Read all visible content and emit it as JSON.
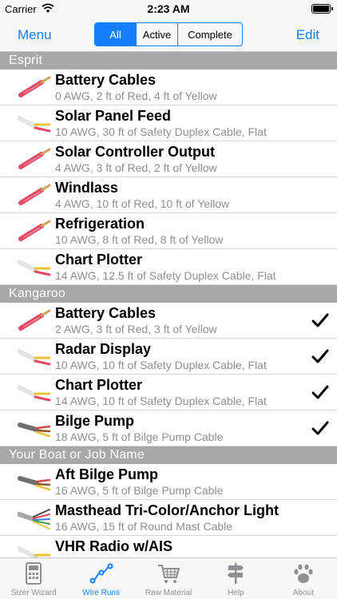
{
  "status_bar": {
    "carrier": "Carrier",
    "time": "2:23 AM"
  },
  "nav": {
    "left_button": "Menu",
    "right_button": "Edit",
    "segments": [
      "All",
      "Active",
      "Complete"
    ],
    "selected_segment": "All"
  },
  "sections": [
    {
      "title": "Esprit",
      "rows": [
        {
          "title": "Battery Cables",
          "subtitle": "0 AWG, 2 ft of Red, 4 ft of Yellow",
          "icon": "red-wire-icon",
          "checked": false
        },
        {
          "title": "Solar Panel Feed",
          "subtitle": "10 AWG, 30 ft of Safety Duplex Cable, Flat",
          "icon": "duplex-cable-icon",
          "checked": false
        },
        {
          "title": "Solar Controller Output",
          "subtitle": "4 AWG, 3 ft of Red, 2 ft of Yellow",
          "icon": "red-wire-icon",
          "checked": false
        },
        {
          "title": "Windlass",
          "subtitle": "4 AWG, 10 ft of Red, 10 ft of Yellow",
          "icon": "red-wire-icon",
          "checked": false
        },
        {
          "title": "Refrigeration",
          "subtitle": "10 AWG, 8 ft of Red, 8 ft of Yellow",
          "icon": "red-wire-icon",
          "checked": false
        },
        {
          "title": "Chart Plotter",
          "subtitle": "14 AWG, 12.5 ft of Safety Duplex Cable, Flat",
          "icon": "duplex-cable-icon",
          "checked": false
        }
      ]
    },
    {
      "title": "Kangaroo",
      "rows": [
        {
          "title": "Battery Cables",
          "subtitle": "2 AWG, 3 ft of Red, 3 ft of Yellow",
          "icon": "red-wire-icon",
          "checked": true
        },
        {
          "title": "Radar Display",
          "subtitle": "10 AWG, 10 ft of Safety Duplex Cable, Flat",
          "icon": "duplex-cable-icon",
          "checked": true
        },
        {
          "title": "Chart Plotter",
          "subtitle": "14 AWG, 10 ft of Safety Duplex Cable, Flat",
          "icon": "duplex-cable-icon",
          "checked": true
        },
        {
          "title": "Bilge Pump",
          "subtitle": "18 AWG, 5 ft of Bilge Pump Cable",
          "icon": "bilge-pump-cable-icon",
          "checked": true
        }
      ]
    },
    {
      "title": "Your Boat or Job Name",
      "rows": [
        {
          "title": "Aft Bilge Pump",
          "subtitle": "16 AWG, 5 ft of Bilge Pump Cable",
          "icon": "bilge-pump-cable-icon",
          "checked": false
        },
        {
          "title": "Masthead Tri-Color/Anchor Light",
          "subtitle": "16 AWG, 15 ft of Round Mast Cable",
          "icon": "mast-cable-icon",
          "checked": false
        },
        {
          "title": "VHR Radio w/AIS",
          "subtitle": "",
          "icon": "duplex-cable-icon",
          "checked": false
        }
      ]
    }
  ],
  "tab_bar": [
    {
      "label": "Sizer Wizard",
      "icon": "calculator-icon",
      "active": false
    },
    {
      "label": "Wire Runs",
      "icon": "wire-runs-icon",
      "active": true
    },
    {
      "label": "Raw Material",
      "icon": "cart-icon",
      "active": false
    },
    {
      "label": "Help",
      "icon": "signpost-icon",
      "active": false
    },
    {
      "label": "About",
      "icon": "paw-icon",
      "active": false
    }
  ],
  "colors": {
    "accent": "#147efb",
    "section_header": "#a8a8a8",
    "subtitle": "#8e8e93"
  }
}
